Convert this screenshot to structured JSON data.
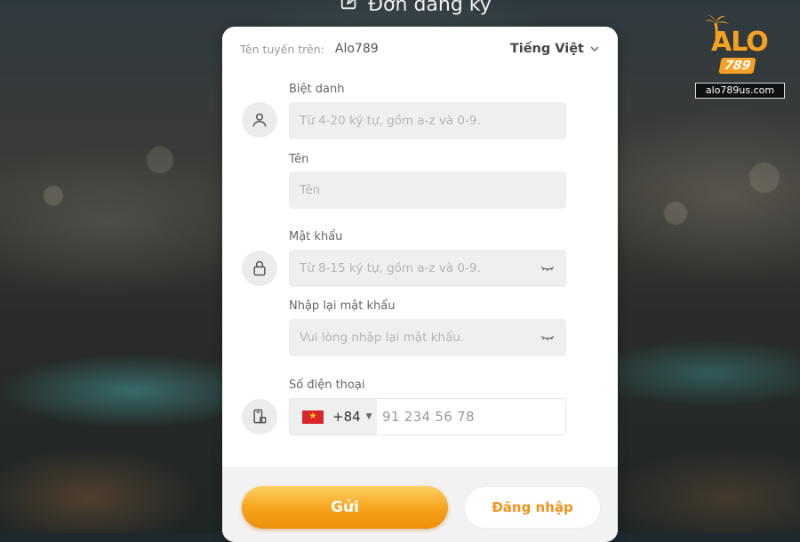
{
  "page": {
    "title": "Đơn đăng ký"
  },
  "brand": {
    "logo_text": "ALO",
    "logo_number": "789",
    "website": "alo789us.com",
    "accent_color": "#f7a123"
  },
  "header": {
    "route_label": "Tên tuyến trên:",
    "route_value": "Alo789",
    "language": "Tiếng Việt"
  },
  "form": {
    "nickname": {
      "label": "Biệt danh",
      "placeholder": "Từ 4-20 ký tự, gồm a-z và 0-9.",
      "icon": "user-icon"
    },
    "name": {
      "label": "Tên",
      "placeholder": "Tên"
    },
    "password": {
      "label": "Mật khẩu",
      "placeholder": "Từ 8-15 ký tự, gồm a-z và 0-9.",
      "icon": "lock-icon"
    },
    "confirm_password": {
      "label": "Nhập lại mật khẩu",
      "placeholder": "Vui lòng nhập lại mật khẩu."
    },
    "phone": {
      "label": "Số điện thoại",
      "country_code": "+84",
      "placeholder": "91 234 56 78",
      "icon": "phone-icon"
    }
  },
  "actions": {
    "submit_label": "Gửi",
    "login_label": "Đăng nhập"
  }
}
